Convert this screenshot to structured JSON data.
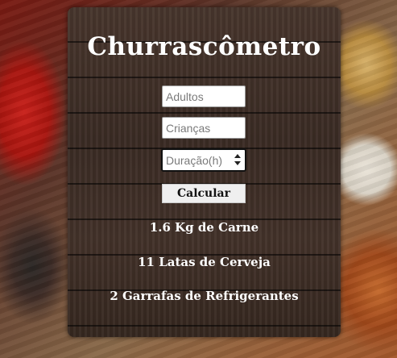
{
  "app": {
    "title": "Churrascômetro"
  },
  "form": {
    "adultos_placeholder": "Adultos",
    "criancas_placeholder": "Crianças",
    "duracao_placeholder": "Duração(h)",
    "calcular_label": "Calcular"
  },
  "results": {
    "carne": "1.6 Kg de Carne",
    "cerveja": "11 Latas de Cerveja",
    "refrigerante": "2 Garrafas de Refrigerantes"
  }
}
